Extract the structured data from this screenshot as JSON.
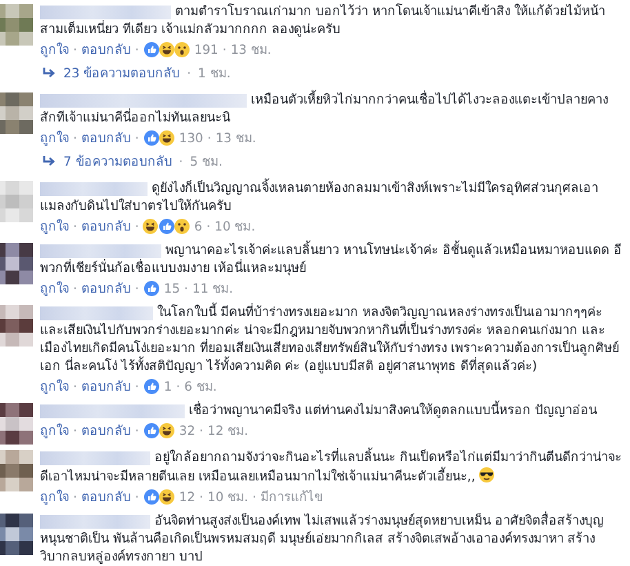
{
  "separator": "·",
  "comments": [
    {
      "text": "ตามตำราโบราณเก่ามาก บอกไว้ว่า หากโดนเจ้าแม่นาคีเข้าสิง ให้แก้ด้วยไม้หน้าสามเต็มเหนี่ยว ทีเดียว เจ้าแม่กลัวมากกกก ลองดูน่ะครับ",
      "like": "ถูกใจ",
      "reply": "ตอบกลับ",
      "reactions": [
        {
          "kind": "like"
        },
        {
          "kind": "haha"
        },
        {
          "kind": "wow"
        }
      ],
      "count": "191",
      "time": "13 ชม.",
      "replies": {
        "label": "23 ข้อความตอบกลับ",
        "time": "1 ชม."
      }
    },
    {
      "text": "เหมือนตัวเหี้ยหิวไก่มากกว่าคนเชื่อไปได้ไงวะลองแตะเข้าปลายคางสักทีเจ้าแม่นาคีนี่ออกไม่ทันเลยนะนิ",
      "like": "ถูกใจ",
      "reply": "ตอบกลับ",
      "reactions": [
        {
          "kind": "like"
        },
        {
          "kind": "haha"
        }
      ],
      "count": "130",
      "time": "13 ชม.",
      "replies": {
        "label": "7 ข้อความตอบกลับ",
        "time": "5 ชม."
      }
    },
    {
      "text": "ดูยังไงก็เป็นวิญญาณจิ้งเหลนตายห้องกลมมาเข้าสิงห์เพราะไม่มีใครอุทิศส่วนกุศลเอาแมลงกับดินไปใส่บาตรไปให้กันครับ",
      "like": "ถูกใจ",
      "reply": "ตอบกลับ",
      "reactions": [
        {
          "kind": "haha"
        },
        {
          "kind": "like"
        },
        {
          "kind": "wow"
        }
      ],
      "count": "6",
      "time": "10 ชม."
    },
    {
      "text": "พญานาคอะไรเจ้าค่ะแลบลิ้นยาว หานโทษน่ะเจ้าค่ะ อิชั้นดูแล้วเหมือนหมาหอบแดด อีพวกที่เชียร์นั่นก้อเชื่อแบบงมงาย เห้อนี่แหละมนุษย์",
      "like": "ถูกใจ",
      "reply": "ตอบกลับ",
      "reactions": [
        {
          "kind": "like"
        }
      ],
      "count": "15",
      "time": "11 ชม."
    },
    {
      "text": "ในโลกใบนี้ มีคนที่บ้าร่างทรงเยอะมาก หลงจิตวิญญาณหลงร่างทรงเป็นเอามากๆๆค่ะ และเสียเงินไปกับพวกร่างเยอะมากค่ะ น่าจะมีกฎหมายจับพวกหากินที่เป็นร่างทรงค่ะ หลอกคนเก่งมาก และเมืองไทยเกิดมีคนโง่เยอะมาก ที่ยอมเสียเงินเสียทองเสียทรัพย์สินให้กับร่างทรง เพราะความต้องการเป็นลูกศิษย์เอก นี่ละคนโง่ ไร้ทั้งสติปัญญา ไร้ทั้งความคิด ค่ะ (อยู่แบบมีสติ อยู่ศาสนาพุทธ ดีที่สุดแล้วค่ะ)",
      "like": "ถูกใจ",
      "reply": "ตอบกลับ",
      "reactions": [
        {
          "kind": "like"
        }
      ],
      "count": "1",
      "time": "6 ชม."
    },
    {
      "text": "เชื่อว่าพญานาคมีจริง แต่ท่านคงไม่มาสิงคนให้ดูตลกแบบนี้หรอก ปัญญาอ่อน",
      "like": "ถูกใจ",
      "reply": "ตอบกลับ",
      "reactions": [
        {
          "kind": "like"
        },
        {
          "kind": "haha"
        }
      ],
      "count": "32",
      "time": "12 ชม."
    },
    {
      "text": "อยู่ใกล้อยากถามจังว่าจะกินอะไรที่แลบลิ้นนะ กินเป็ดหรือไก่แต่มีมาว่ากินตีนดีกว่าน่าจะดีเอาไหมน่าจะมีหลายตีนเลย เหมือนเลยเหมือนมากไม่ใช่เจ้าแม่นาคีนะตัวเอี้ยนะ,,",
      "trailing": {
        "kind": "sunglasses"
      },
      "like": "ถูกใจ",
      "reply": "ตอบกลับ",
      "reactions": [
        {
          "kind": "like"
        },
        {
          "kind": "haha"
        }
      ],
      "count": "12",
      "time": "10 ชม.",
      "edited": "มีการแก้ไข"
    },
    {
      "text": "อันจิตท่านสูงส่งเป็นองค์เทพ ไม่เสพแล้วร่างมนุษย์สุดหยาบเหม็น อาศัยจิตสื่อสร้างบุญหนุนชาติเป็น พันล้านคือเกิดเป็นพรหมสมฤดี มนุษย์เอ่ยมากกิเลส สร้างจิตเสพอ้างเอาองค์ทรงมาหา สร้างวิบากลบหลู่องค์ทรงกายา บาป"
    }
  ]
}
